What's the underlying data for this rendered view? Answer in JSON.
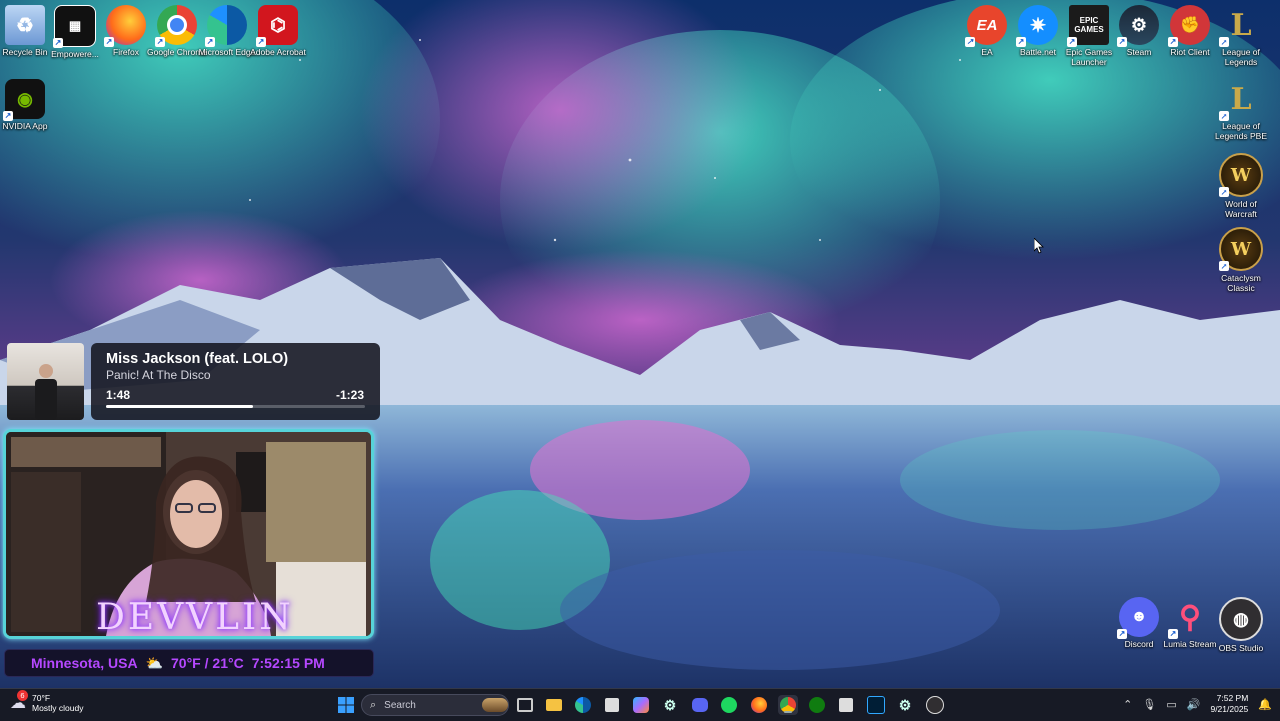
{
  "desktop": {
    "left_icons": [
      {
        "label": "Recycle Bin",
        "icon": "recycle-bin-icon"
      },
      {
        "label": "Empowere...",
        "icon": "empower-icon"
      },
      {
        "label": "Firefox",
        "icon": "firefox-icon"
      },
      {
        "label": "Google Chrome",
        "icon": "chrome-icon"
      },
      {
        "label": "Microsoft Edge",
        "icon": "edge-icon"
      },
      {
        "label": "Adobe Acrobat",
        "icon": "acrobat-icon"
      },
      {
        "label": "NVIDIA App",
        "icon": "nvidia-icon"
      }
    ],
    "right_icons": [
      {
        "label": "EA",
        "glyph": "EA",
        "icon": "ea-icon"
      },
      {
        "label": "Battle.net",
        "icon": "battlenet-icon"
      },
      {
        "label": "Epic Games Launcher",
        "glyph": "EPIC GAMES",
        "icon": "epic-games-icon"
      },
      {
        "label": "Steam",
        "icon": "steam-icon"
      },
      {
        "label": "Riot Client",
        "icon": "riot-client-icon"
      },
      {
        "label": "League of Legends",
        "glyph": "L",
        "icon": "league-icon"
      },
      {
        "label": "League of Legends PBE",
        "glyph": "L",
        "icon": "league-pbe-icon"
      },
      {
        "label": "World of Warcraft",
        "glyph": "W",
        "icon": "wow-icon"
      },
      {
        "label": "Cataclysm Classic",
        "glyph": "W",
        "icon": "cataclysm-icon"
      },
      {
        "label": "Discord",
        "icon": "discord-icon"
      },
      {
        "label": "Lumia Stream",
        "icon": "lumia-icon"
      },
      {
        "label": "OBS Studio",
        "icon": "obs-icon"
      }
    ]
  },
  "media": {
    "title": "Miss Jackson (feat. LOLO)",
    "artist": "Panic! At The Disco",
    "elapsed": "1:48",
    "remaining": "-1:23",
    "progress_fraction": 0.566
  },
  "webcam": {
    "overlay_name": "DEVVLIN",
    "location": "Minnesota, USA",
    "weather": "70°F / 21°C",
    "time": "7:52:15 PM"
  },
  "taskbar": {
    "weather_temp": "70°F",
    "weather_desc": "Mostly cloudy",
    "weather_badge": "6",
    "search_placeholder": "Search",
    "pinned": [
      "task-view-icon",
      "file-explorer-icon",
      "edge-icon",
      "store-icon",
      "copilot-icon",
      "steam-icon",
      "discord-icon",
      "spotify-icon",
      "firefox-icon",
      "chrome-icon",
      "xbox-icon",
      "snipping-icon",
      "photoshop-icon",
      "steam-icon",
      "obs-icon"
    ],
    "clock_time": "7:52 PM",
    "clock_date": "9/21/2025"
  },
  "colors": {
    "accent_cam": "#57d3d8",
    "info_text": "#b548ff",
    "taskbar": "#181a24"
  }
}
